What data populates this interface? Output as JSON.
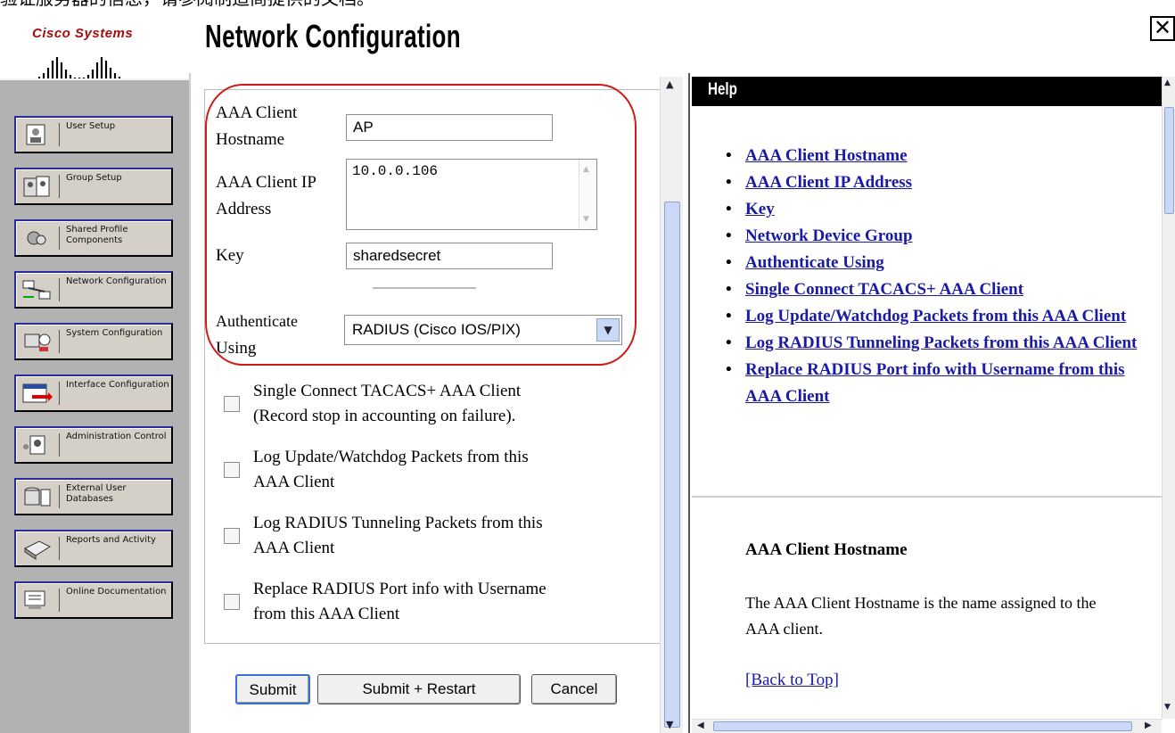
{
  "top_caption": "验证服务器的信息，请参阅制造商提供的文档。",
  "logo": {
    "text": "Cisco Systems"
  },
  "page_title": "Network Configuration",
  "close_label": "✕",
  "nav": {
    "items": [
      {
        "label": "User Setup",
        "icon": "user-setup-icon"
      },
      {
        "label": "Group Setup",
        "icon": "group-setup-icon"
      },
      {
        "label": "Shared Profile Components",
        "icon": "shared-profile-icon"
      },
      {
        "label": "Network Configuration",
        "icon": "network-config-icon"
      },
      {
        "label": "System Configuration",
        "icon": "system-config-icon"
      },
      {
        "label": "Interface Configuration",
        "icon": "interface-config-icon"
      },
      {
        "label": "Administration Control",
        "icon": "admin-control-icon"
      },
      {
        "label": "External User Databases",
        "icon": "external-db-icon"
      },
      {
        "label": "Reports and Activity",
        "icon": "reports-icon"
      },
      {
        "label": "Online Documentation",
        "icon": "documentation-icon"
      }
    ]
  },
  "form": {
    "hostname_label_1": "AAA Client",
    "hostname_label_2": "Hostname",
    "hostname_value": "AP",
    "ip_label_1": "AAA Client IP",
    "ip_label_2": "Address",
    "ip_value": "10.0.0.106",
    "key_label": "Key",
    "key_value": "sharedsecret",
    "auth_label_1": "Authenticate",
    "auth_label_2": "Using",
    "auth_value": "RADIUS (Cisco IOS/PIX)",
    "checkboxes": [
      {
        "line1": "Single Connect TACACS+ AAA Client",
        "line2": "(Record stop in accounting on failure).",
        "checked": false
      },
      {
        "line1": "Log Update/Watchdog Packets from this",
        "line2": "AAA Client",
        "checked": false
      },
      {
        "line1": "Log RADIUS Tunneling Packets from this",
        "line2": "AAA Client",
        "checked": false
      },
      {
        "line1": "Replace RADIUS Port info with Username",
        "line2": "from this AAA Client",
        "checked": false
      }
    ]
  },
  "buttons": {
    "submit": "Submit",
    "submit_restart": "Submit + Restart",
    "cancel": "Cancel"
  },
  "help": {
    "title": "Help",
    "links": [
      "AAA Client Hostname",
      "AAA Client IP Address",
      "Key",
      "Network Device Group",
      "Authenticate Using",
      "Single Connect TACACS+ AAA Client",
      "Log Update/Watchdog Packets from this AAA Client",
      "Log RADIUS Tunneling Packets from this AAA Client",
      "Replace RADIUS Port info with Username from this AAA Client"
    ],
    "section_heading": "AAA Client Hostname",
    "section_text": "The AAA Client Hostname is the name assigned to the AAA client.",
    "back_to_top": "[Back to Top]"
  },
  "colors": {
    "highlight_oval": "#d01a1a",
    "link": "#1a1aa6",
    "nav_background": "#b2b2b2"
  }
}
